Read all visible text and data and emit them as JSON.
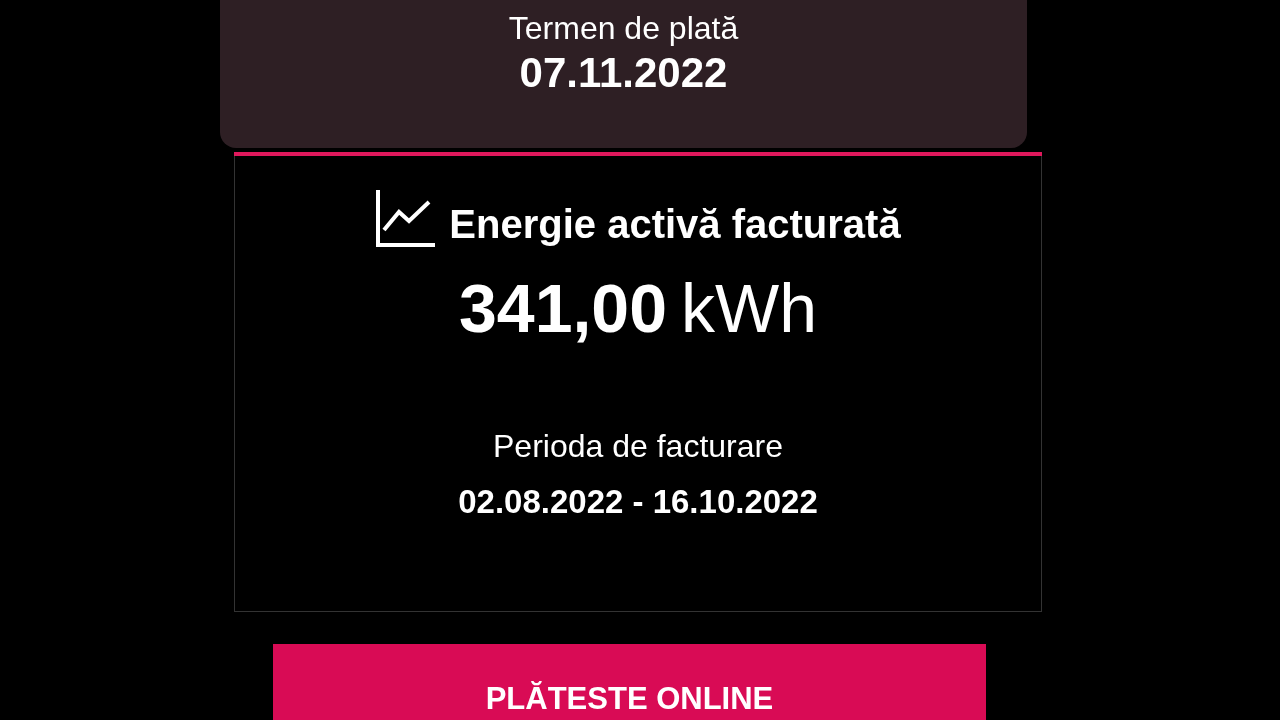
{
  "due": {
    "label": "Termen de plată",
    "date": "07.11.2022"
  },
  "energy": {
    "title": "Energie activă facturată",
    "amount": "341,00",
    "unit": "kWh",
    "period_label": "Perioda de facturare",
    "period": "02.08.2022 - 16.10.2022"
  },
  "pay_button": {
    "label": "PLĂTESTE ONLINE"
  }
}
